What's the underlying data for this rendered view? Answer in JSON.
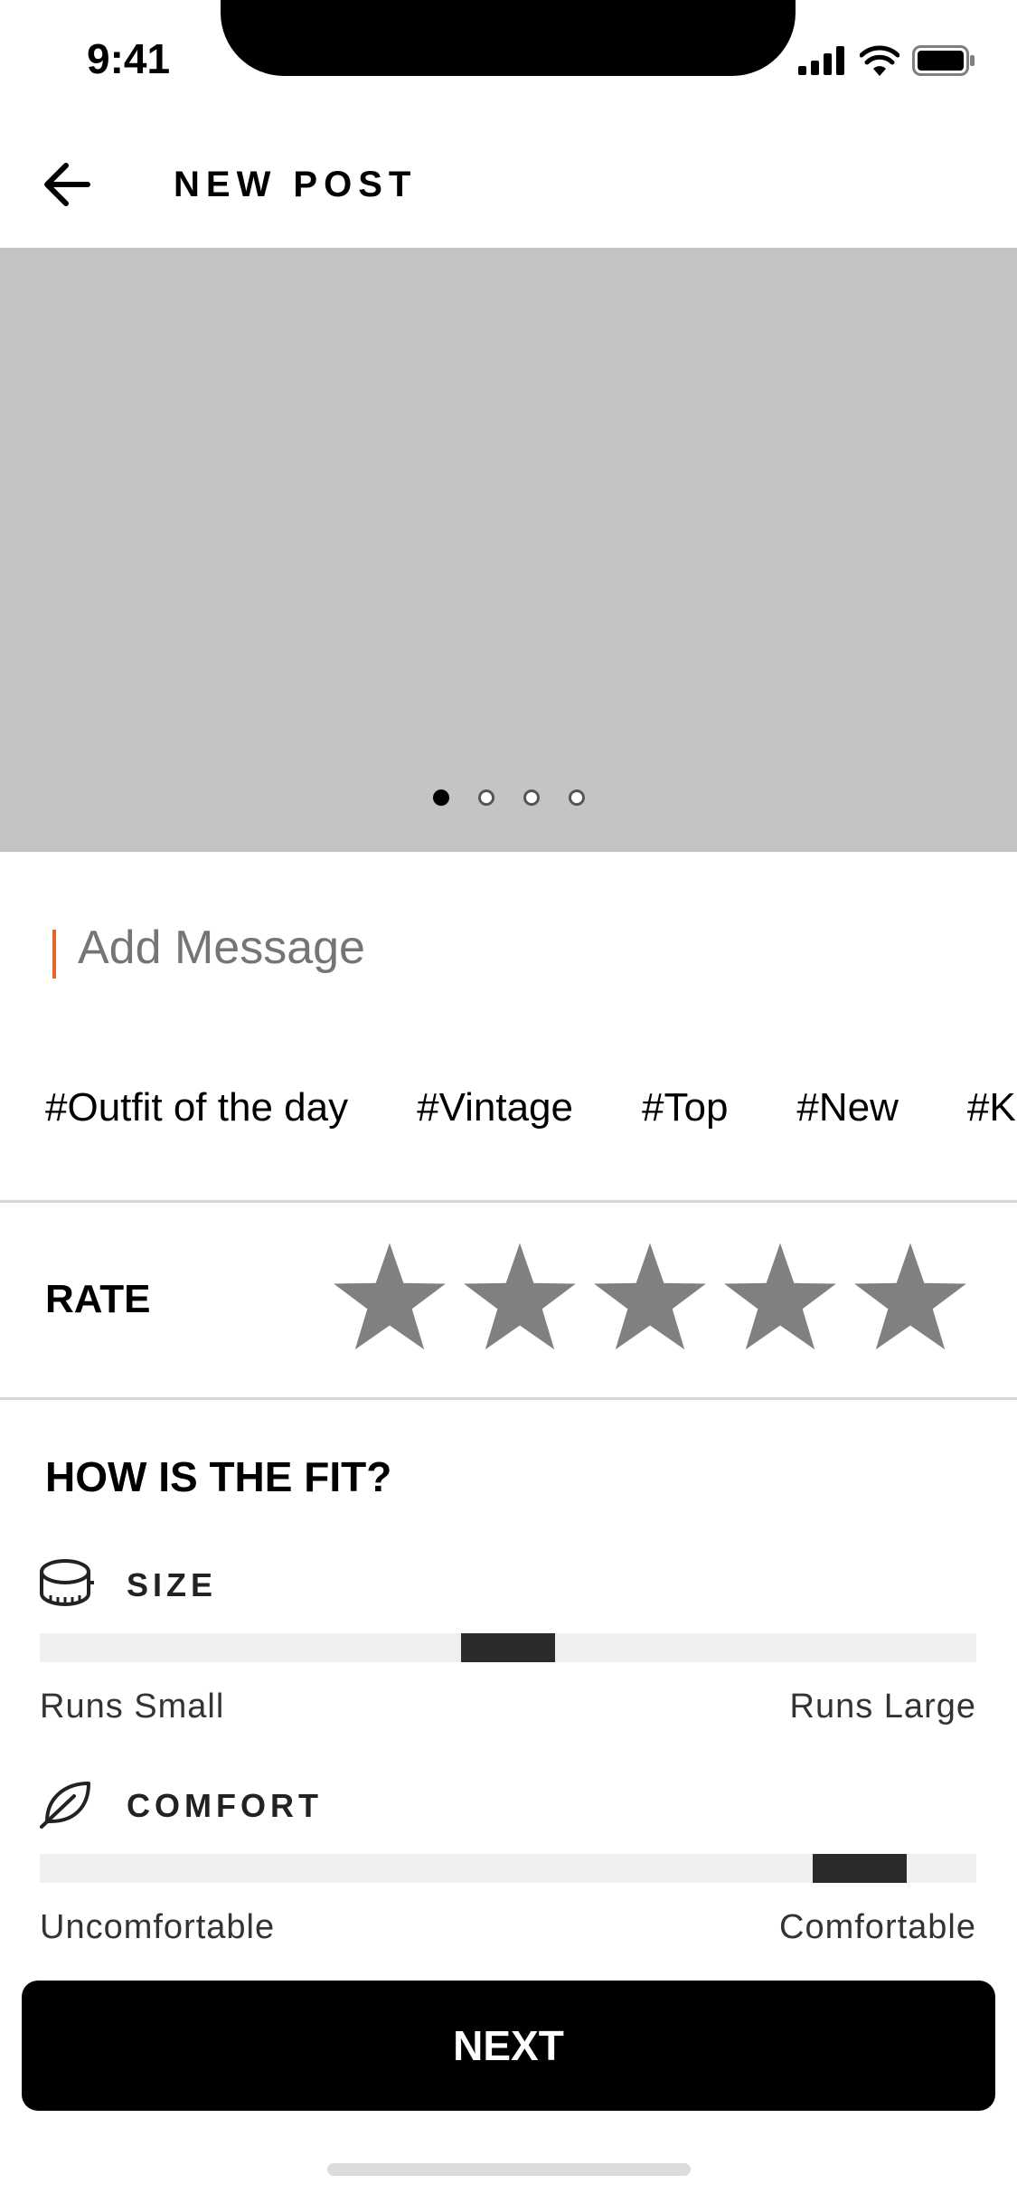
{
  "status_bar": {
    "time": "9:41",
    "icons": [
      "cellular-signal-icon",
      "wifi-icon",
      "battery-icon"
    ]
  },
  "header": {
    "back_icon": "arrow-left-icon",
    "title": "NEW POST"
  },
  "carousel": {
    "page_count": 4,
    "active_index": 0,
    "background": "#c4c4c4"
  },
  "message": {
    "placeholder": "Add Message",
    "caret_color": "#e5642a"
  },
  "hashtags": [
    "#Outfit of the day",
    "#Vintage",
    "#Top",
    "#New",
    "#Ki"
  ],
  "rate": {
    "label": "RATE",
    "max_stars": 5,
    "selected_stars": 0,
    "star_color": "#808080"
  },
  "fit": {
    "heading": "HOW IS THE FIT?",
    "size": {
      "icon": "measuring-tape-icon",
      "label": "SIZE",
      "min_label": "Runs Small",
      "max_label": "Runs Large",
      "value_fraction": 0.5
    },
    "comfort": {
      "icon": "leaf-icon",
      "label": "COMFORT",
      "min_label": "Uncomfortable",
      "max_label": "Comfortable",
      "value_fraction": 0.875
    }
  },
  "footer": {
    "next_label": "NEXT"
  }
}
